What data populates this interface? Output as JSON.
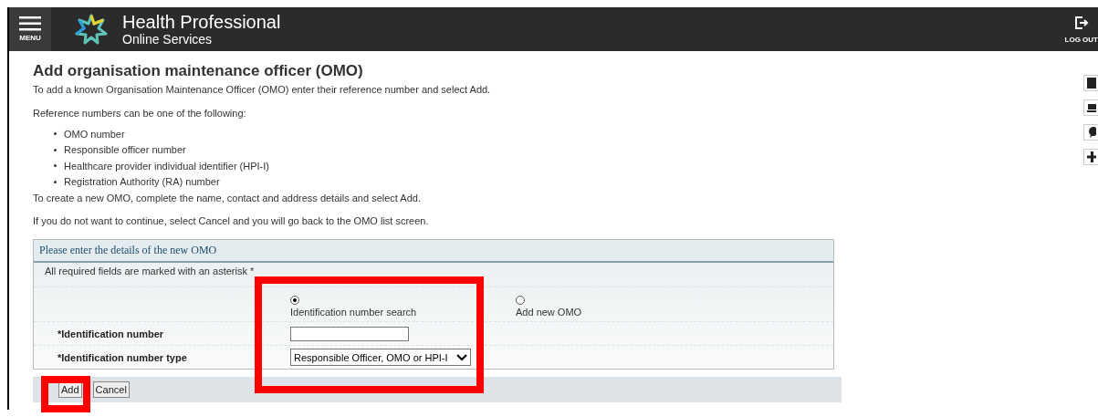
{
  "header": {
    "menu_label": "MENU",
    "title": "Health Professional",
    "subtitle": "Online Services",
    "logout_label": "LOG OUT"
  },
  "page": {
    "title": "Add organisation maintenance officer (OMO)",
    "intro": "To add a known Organisation Maintenance Officer (OMO) enter their reference number and select Add.",
    "list_intro": "Reference numbers can be one of the following:",
    "reference_types": [
      "OMO number",
      "Responsible officer number",
      "Healthcare provider individual identifier (HPI-I)",
      "Registration Authority (RA) number"
    ],
    "notes": [
      "To create a new OMO, complete the name, contact and address details and select Add.",
      "If you do not want to continue, select Cancel and you will go back to the OMO list screen."
    ]
  },
  "form": {
    "heading": "Please enter the details of the new OMO",
    "required_note": "All required fields are marked with an asterisk *",
    "options": [
      {
        "label": "Identification number search",
        "selected": true
      },
      {
        "label": "Add new OMO",
        "selected": false
      }
    ],
    "fields": [
      {
        "kind": "text",
        "label": "*Identification number"
      },
      {
        "kind": "select",
        "label": "*Identification number type",
        "value": "Responsible Officer, OMO or HPI-I"
      }
    ],
    "buttons": [
      "Add",
      "Cancel"
    ]
  }
}
